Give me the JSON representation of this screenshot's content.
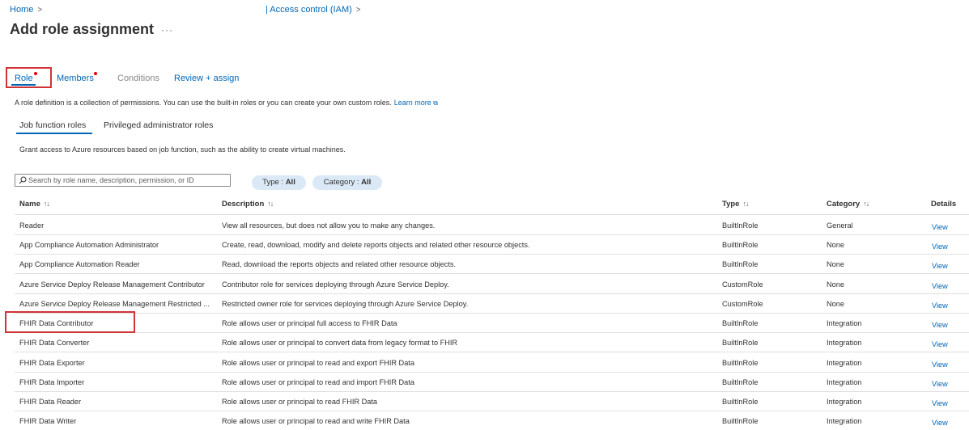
{
  "breadcrumb": {
    "home": "Home",
    "iam": "| Access control (IAM)"
  },
  "page": {
    "title": "Add role assignment",
    "more": "···"
  },
  "wizard_tabs": [
    {
      "label": "Role",
      "required": true
    },
    {
      "label": "Members",
      "required": true
    },
    {
      "label": "Conditions",
      "required": false
    },
    {
      "label": "Review + assign",
      "required": false
    }
  ],
  "description": {
    "text": "A role definition is a collection of permissions. You can use the built-in roles or you can create your own custom roles.",
    "learn_more": "Learn more"
  },
  "sub_tabs": [
    "Job function roles",
    "Privileged administrator roles"
  ],
  "grant_text": "Grant access to Azure resources based on job function, such as the ability to create virtual machines.",
  "search": {
    "placeholder": "Search by role name, description, permission, or ID",
    "value": ""
  },
  "filters": {
    "type": {
      "label": "Type :",
      "value": "All"
    },
    "category": {
      "label": "Category :",
      "value": "All"
    }
  },
  "table": {
    "columns": [
      "Name",
      "Description",
      "Type",
      "Category",
      "Details"
    ],
    "rows": [
      [
        "Reader",
        "View all resources, but does not allow you to make any changes.",
        "BuiltInRole",
        "General",
        "View"
      ],
      [
        "App Compliance Automation Administrator",
        "Create, read, download, modify and delete reports objects and related other resource objects.",
        "BuiltInRole",
        "None",
        "View"
      ],
      [
        "App Compliance Automation Reader",
        "Read, download the reports objects and related other resource objects.",
        "BuiltInRole",
        "None",
        "View"
      ],
      [
        "Azure Service Deploy Release Management Contributor",
        "Contributor role for services deploying through Azure Service Deploy.",
        "CustomRole",
        "None",
        "View"
      ],
      [
        "Azure Service Deploy Release Management Restricted ...",
        "Restricted owner role for services deploying through Azure Service Deploy.",
        "CustomRole",
        "None",
        "View"
      ],
      [
        "FHIR Data Contributor",
        "Role allows user or principal full access to FHIR Data",
        "BuiltInRole",
        "Integration",
        "View"
      ],
      [
        "FHIR Data Converter",
        "Role allows user or principal to convert data from legacy format to FHIR",
        "BuiltInRole",
        "Integration",
        "View"
      ],
      [
        "FHIR Data Exporter",
        "Role allows user or principal to read and export FHIR Data",
        "BuiltInRole",
        "Integration",
        "View"
      ],
      [
        "FHIR Data Importer",
        "Role allows user or principal to read and import FHIR Data",
        "BuiltInRole",
        "Integration",
        "View"
      ],
      [
        "FHIR Data Reader",
        "Role allows user or principal to read FHIR Data",
        "BuiltInRole",
        "Integration",
        "View"
      ],
      [
        "FHIR Data Writer",
        "Role allows user or principal to read and write FHIR Data",
        "BuiltInRole",
        "Integration",
        "View"
      ]
    ]
  },
  "colors": {
    "accent": "#0067b8",
    "highlight": "#d13438",
    "required_dot": "#e00000",
    "pill_bg": "#dbe9f7"
  }
}
